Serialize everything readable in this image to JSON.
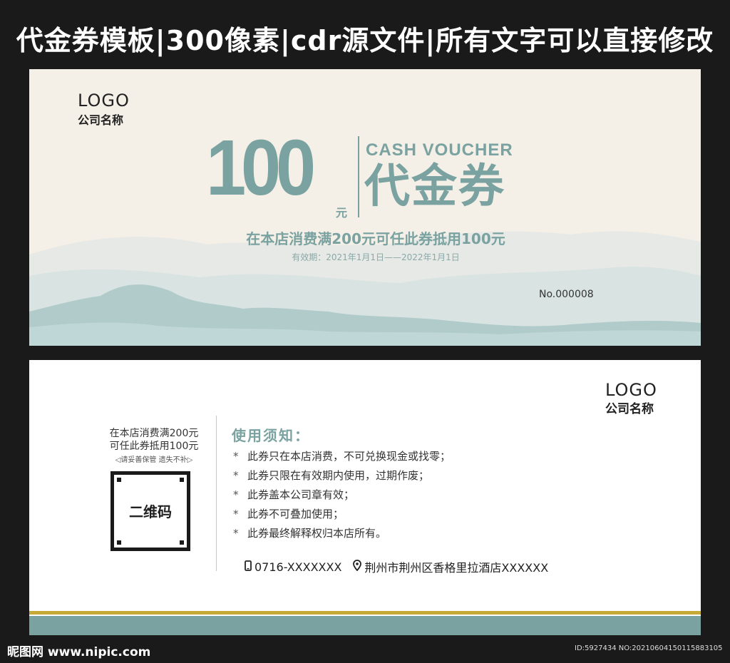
{
  "header": {
    "title": "代金券模板|300像素|cdr源文件|所有文字可以直接修改"
  },
  "front": {
    "logo": "LOGO",
    "company": "公司名称",
    "amount": "100",
    "currency": "元",
    "cash_voucher": "CASH VOUCHER",
    "voucher_title": "代金券",
    "offer": "在本店消费满200元可任此券抵用100元",
    "validity": "有效期：2021年1月1日——2022年1月1日",
    "serial": "No.000008"
  },
  "back": {
    "logo": "LOGO",
    "company": "公司名称",
    "stub_line1": "在本店消费满200元",
    "stub_line2": "可任此券抵用100元",
    "stub_note": "◁请妥善保管  遗失不补▷",
    "qr_label": "二维码",
    "notice_title": "使用须知：",
    "rule_bullet": "*",
    "rules": [
      "此券只在本店消费，不可兑换现金或找零；",
      "此券只限在有效期内使用，过期作废；",
      "此券盖本公司章有效；",
      "此券不可叠加使用；",
      "此券最终解释权归本店所有。"
    ],
    "phone": "0716-XXXXXXX",
    "address": "荆州市荆州区香格里拉酒店XXXXXX"
  },
  "footer": {
    "watermark_left": "昵图网 www.nipic.com",
    "watermark_right": "ID:5927434 NO:20210604150115883105"
  },
  "colors": {
    "accent": "#7aa2a0",
    "gold": "#c6a936",
    "front_background": "#f4efe7",
    "page_background": "#1a1a1a"
  }
}
